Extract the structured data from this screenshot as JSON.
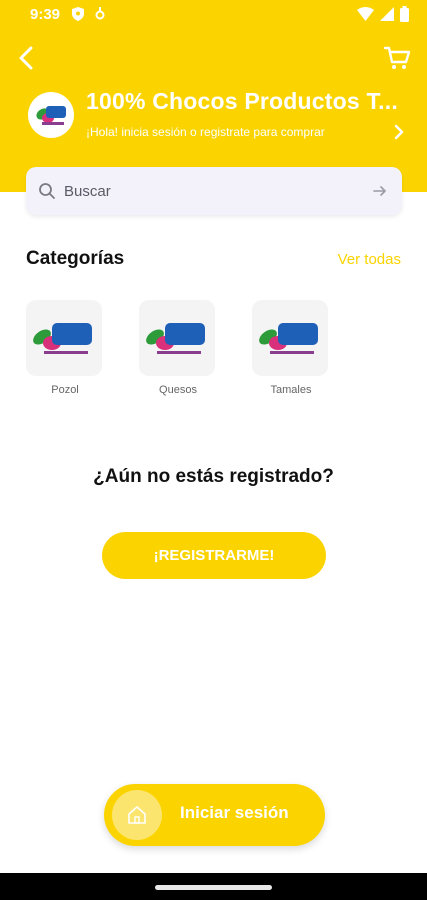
{
  "status_bar": {
    "time": "9:39"
  },
  "header": {
    "store_title": "100% Chocos Productos T...",
    "subtitle": "¡Hola! inicia sesión o registrate para comprar"
  },
  "search": {
    "placeholder": "Buscar"
  },
  "categories": {
    "title": "Categorías",
    "see_all_label": "Ver todas",
    "items": [
      {
        "label": "Pozol"
      },
      {
        "label": "Quesos"
      },
      {
        "label": "Tamales"
      }
    ]
  },
  "register": {
    "question": "¿Aún no estás registrado?",
    "button_label": "¡REGISTRARME!"
  },
  "login": {
    "label": "Iniciar sesión"
  },
  "colors": {
    "accent": "#FBD400",
    "accent_light": "#FCE56E",
    "search_bg": "#F3F2FA"
  },
  "icons": [
    "back-arrow-icon",
    "cart-icon",
    "chevron-right-icon",
    "search-icon",
    "arrow-right-icon",
    "home-icon"
  ]
}
